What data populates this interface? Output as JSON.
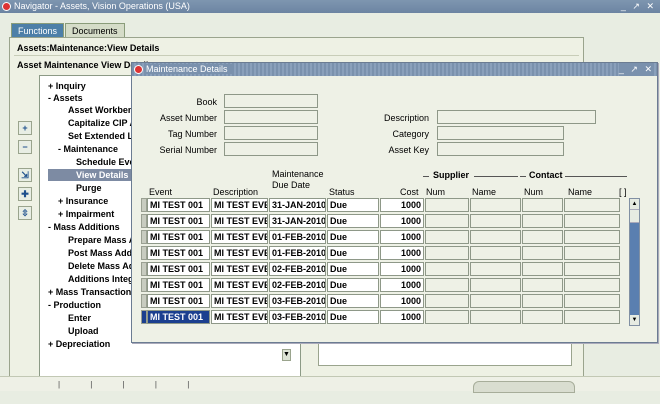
{
  "navigator": {
    "title": "Navigator - Assets, Vision Operations (USA)",
    "controls": "_ ↗ ✕",
    "tabs": [
      {
        "label": "Functions",
        "active": true
      },
      {
        "label": "Documents",
        "active": false
      }
    ],
    "path": "Assets:Maintenance:View Details",
    "section_title": "Asset Maintenance View Details"
  },
  "tree": [
    {
      "label": "+ Inquiry"
    },
    {
      "label": "- Assets"
    },
    {
      "label": "Asset Workbench"
    },
    {
      "label": "Capitalize CIP Assets"
    },
    {
      "label": "Set Extended Life"
    },
    {
      "label": "- Maintenance"
    },
    {
      "label": "Schedule Events"
    },
    {
      "label": "View Details"
    },
    {
      "label": "Purge"
    },
    {
      "label": "+ Insurance"
    },
    {
      "label": "+ Impairment"
    },
    {
      "label": "- Mass Additions"
    },
    {
      "label": "Prepare Mass Additions"
    },
    {
      "label": "Post Mass Additions"
    },
    {
      "label": "Delete Mass Additions"
    },
    {
      "label": "Additions Integrator"
    },
    {
      "label": "+ Mass Transactions"
    },
    {
      "label": "- Production"
    },
    {
      "label": "Enter"
    },
    {
      "label": "Upload"
    },
    {
      "label": "+ Depreciation"
    }
  ],
  "side_buttons": [
    {
      "icon": "expand-icon",
      "glyph": "+"
    },
    {
      "icon": "collapse-icon",
      "glyph": "−"
    },
    {
      "icon": "expand-branch-icon",
      "glyph": "⇲"
    },
    {
      "icon": "expand-all-icon",
      "glyph": "✚"
    },
    {
      "icon": "collapse-all-icon",
      "glyph": "⇳"
    }
  ],
  "dialog": {
    "title": "Maintenance Details",
    "controls": "_ ↗ ✕",
    "fields": {
      "book": {
        "label": "Book",
        "value": ""
      },
      "asset_number": {
        "label": "Asset Number",
        "value": ""
      },
      "tag_number": {
        "label": "Tag Number",
        "value": ""
      },
      "serial_number": {
        "label": "Serial Number",
        "value": ""
      },
      "description": {
        "label": "Description",
        "value": ""
      },
      "category": {
        "label": "Category",
        "value": ""
      },
      "asset_key": {
        "label": "Asset Key",
        "value": ""
      }
    },
    "columns": {
      "event": "Event",
      "description": "Description",
      "due_date_line1": "Maintenance",
      "due_date_line2": "Due Date",
      "status": "Status",
      "cost": "Cost",
      "supplier_group": "Supplier",
      "supplier_num": "Num",
      "supplier_name": "Name",
      "contact_group": "Contact",
      "contact_num": "Num",
      "contact_name": "Name",
      "brackets": "[ ]"
    },
    "rows": [
      {
        "event": "MI TEST 001",
        "description": "MI TEST EVE",
        "due_date": "31-JAN-2010",
        "status": "Due",
        "cost": "1000"
      },
      {
        "event": "MI TEST 001",
        "description": "MI TEST EVE",
        "due_date": "31-JAN-2010",
        "status": "Due",
        "cost": "1000"
      },
      {
        "event": "MI TEST 001",
        "description": "MI TEST EVE",
        "due_date": "01-FEB-2010",
        "status": "Due",
        "cost": "1000"
      },
      {
        "event": "MI TEST 001",
        "description": "MI TEST EVE",
        "due_date": "01-FEB-2010",
        "status": "Due",
        "cost": "1000"
      },
      {
        "event": "MI TEST 001",
        "description": "MI TEST EVE",
        "due_date": "02-FEB-2010",
        "status": "Due",
        "cost": "1000"
      },
      {
        "event": "MI TEST 001",
        "description": "MI TEST EVE",
        "due_date": "02-FEB-2010",
        "status": "Due",
        "cost": "1000"
      },
      {
        "event": "MI TEST 001",
        "description": "MI TEST EVE",
        "due_date": "03-FEB-2010",
        "status": "Due",
        "cost": "1000"
      },
      {
        "event": "MI TEST 001",
        "description": "MI TEST EVE",
        "due_date": "03-FEB-2010",
        "status": "Due",
        "cost": "1000"
      }
    ],
    "selected_row": 7
  },
  "colors": {
    "title_bar": "#7a91ad",
    "tab_active": "#4d7fa8",
    "selection": "#1b3f8f",
    "tree_selected": "#7d8ba3"
  }
}
